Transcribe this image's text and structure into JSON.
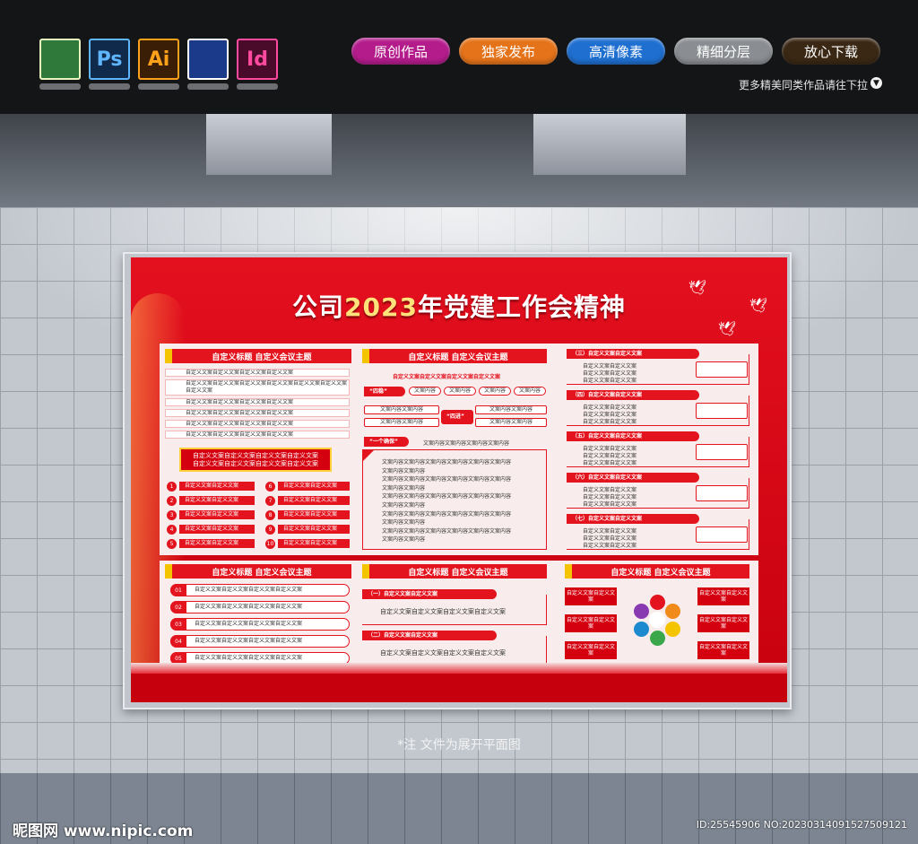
{
  "toolbar": {
    "software_icons": [
      {
        "label": "",
        "icon": "coreldraw-icon",
        "bg": "#2f7a3a",
        "fg": "#e8f5c0"
      },
      {
        "label": "Ps",
        "icon": "photoshop-icon",
        "bg": "#0f2a4a",
        "fg": "#5fb6ff"
      },
      {
        "label": "Ai",
        "icon": "illustrator-icon",
        "bg": "#3a1e05",
        "fg": "#ffa11a"
      },
      {
        "label": "",
        "icon": "cinema4d-icon",
        "bg": "#1c3a8a",
        "fg": "#ffffff"
      },
      {
        "label": "Id",
        "icon": "indesign-icon",
        "bg": "#4a0a2a",
        "fg": "#ff4aa0"
      }
    ],
    "pills": [
      {
        "label": "原创作品",
        "color": "#b41c8c"
      },
      {
        "label": "独家发布",
        "color": "#e4731a"
      },
      {
        "label": "高清像素",
        "color": "#1f6fd0"
      },
      {
        "label": "精细分层",
        "color": "#8a8d92"
      },
      {
        "label": "放心下载",
        "color": "#3a2814"
      }
    ],
    "more_text": "更多精美同类作品请往下拉",
    "more_icon": "chevron-down-icon"
  },
  "poster": {
    "title_prefix": "公司",
    "title_year": "2023",
    "title_suffix": "年党建工作会精神",
    "col1": {
      "header": "自定义标题 自定义会议主题",
      "rows": [
        "自定义文案自定义文案自定义文案自定义文案",
        "自定义文案自定义文案自定义文案自定义文案自定义文案自定义文案自定义文案",
        "自定义文案自定义文案自定义文案自定义文案",
        "自定义文案自定义文案自定义文案自定义文案",
        "自定义文案自定义文案自定义文案自定义文案",
        "自定义文案自定义文案自定义文案自定义文案"
      ],
      "box": [
        "自定义文案自定义文案自定义文案自定义文案",
        "自定义文案自定义文案自定义文案自定义文案"
      ],
      "numbered_left": [
        {
          "n": "1",
          "t": "自定义文案自定义文案"
        },
        {
          "n": "2",
          "t": "自定义文案自定义文案"
        },
        {
          "n": "3",
          "t": "自定义文案自定义文案"
        },
        {
          "n": "4",
          "t": "自定义文案自定义文案"
        },
        {
          "n": "5",
          "t": "自定义文案自定义文案"
        }
      ],
      "numbered_right": [
        {
          "n": "6",
          "t": "自定义文案自定义文案"
        },
        {
          "n": "7",
          "t": "自定义文案自定义文案"
        },
        {
          "n": "8",
          "t": "自定义文案自定义文案"
        },
        {
          "n": "9",
          "t": "自定义文案自定义文案"
        },
        {
          "n": "10",
          "t": "自定义文案自定义文案"
        }
      ]
    },
    "col2": {
      "header": "自定义标题 自定义会议主题",
      "sub": "自定义文案自定义文案自定义文案自定义文案",
      "siwen_tag": "“四稳”",
      "siwen_items": [
        "文案内容",
        "文案内容",
        "文案内容",
        "文案内容"
      ],
      "sijin_tag": "“四进”",
      "sijin_left": [
        "文案内容文案内容",
        "文案内容文案内容"
      ],
      "sijin_right": [
        "文案内容文案内容",
        "文案内容文案内容"
      ],
      "yigequebao_tag": "“一个确保”",
      "yigequebao_text": "文案内容文案内容文案内容文案内容",
      "paragraphs": [
        "文案内容文案内容文案内容文案内容文案内容文案内容",
        "文案内容文案内容",
        "文案内容文案内容文案内容文案内容文案内容文案内容",
        "文案内容文案内容",
        "文案内容文案内容文案内容文案内容文案内容文案内容",
        "文案内容文案内容",
        "文案内容文案内容文案内容文案内容文案内容文案内容",
        "文案内容文案内容",
        "文案内容文案内容文案内容文案内容文案内容文案内容",
        "文案内容文案内容"
      ]
    },
    "col3_sections": [
      {
        "tag": "（三）自定义文案自定义文案",
        "lines": [
          "自定义文案自定义文案",
          "自定义文案自定义文案",
          "自定义文案自定义文案"
        ]
      },
      {
        "tag": "（四）自定义文案自定义文案",
        "lines": [
          "自定义文案自定义文案",
          "自定义文案自定义文案",
          "自定义文案自定义文案"
        ]
      },
      {
        "tag": "（五）自定义文案自定义文案",
        "lines": [
          "自定义文案自定义文案",
          "自定义文案自定义文案",
          "自定义文案自定义文案"
        ]
      },
      {
        "tag": "（六）自定义文案自定义文案",
        "lines": [
          "自定义文案自定义文案",
          "自定义文案自定义文案",
          "自定义文案自定义文案"
        ]
      },
      {
        "tag": "（七）自定义文案自定义文案",
        "lines": [
          "自定义文案自定义文案",
          "自定义文案自定义文案",
          "自定义文案自定义文案"
        ]
      }
    ],
    "bottom1": {
      "header": "自定义标题 自定义会议主题",
      "rows": [
        {
          "n": "01",
          "t": "自定义文案自定义文案自定义文案自定义文案"
        },
        {
          "n": "02",
          "t": "自定义文案自定义文案自定义文案自定义文案"
        },
        {
          "n": "03",
          "t": "自定义文案自定义文案自定义文案自定义文案"
        },
        {
          "n": "04",
          "t": "自定义文案自定义文案自定义文案自定义文案"
        },
        {
          "n": "05",
          "t": "自定义文案自定义文案自定义文案自定义文案"
        }
      ]
    },
    "bottom2": {
      "header": "自定义标题 自定义会议主题",
      "sections": [
        {
          "tag": "（一）自定义文案自定义文案",
          "text": "自定义文案自定义文案自定义文案自定义文案"
        },
        {
          "tag": "（二）自定义文案自定义文案",
          "text": "自定义文案自定义文案自定义文案自定义文案"
        }
      ]
    },
    "bottom3": {
      "header": "自定义标题 自定义会议主题",
      "left": [
        "自定义文案自定义文案",
        "自定义文案自定义文案",
        "自定义文案自定义文案"
      ],
      "right": [
        "自定义文案自定义文案",
        "自定义文案自定义文案",
        "自定义文案自定义文案"
      ],
      "ring_colors": [
        "#e4141f",
        "#f08a1a",
        "#f5c400",
        "#3aa84a",
        "#1d8ad0",
        "#8a3ab0"
      ]
    }
  },
  "note": "*注  文件为展开平面图",
  "watermark_left": "昵图网 www.nipic.com",
  "watermark_right": "ID:25545906 NO:20230314091527509121"
}
